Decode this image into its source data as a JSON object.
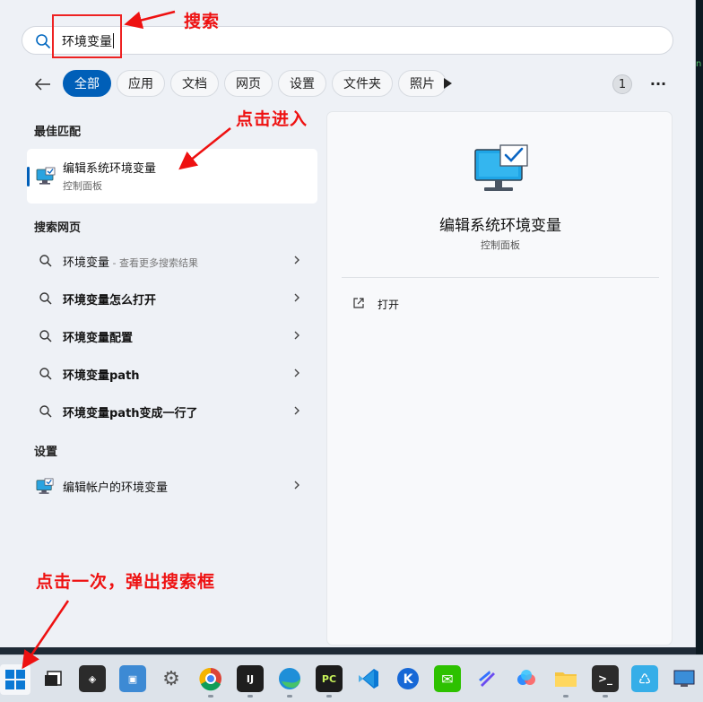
{
  "search": {
    "query": "环境变量"
  },
  "filters": [
    "全部",
    "应用",
    "文档",
    "网页",
    "设置",
    "文件夹",
    "照片"
  ],
  "active_filter": "全部",
  "results_count": "1",
  "best_match": {
    "heading": "最佳匹配",
    "title": "编辑系统环境变量",
    "subtitle": "控制面板"
  },
  "web_search": {
    "heading": "搜索网页",
    "items": [
      {
        "text": "环境变量",
        "suffix": " - 查看更多搜索结果"
      },
      {
        "text": "环境变量怎么打开",
        "suffix": ""
      },
      {
        "text": "环境变量配置",
        "suffix": ""
      },
      {
        "text": "环境变量path",
        "suffix": ""
      },
      {
        "text": "环境变量path变成一行了",
        "suffix": ""
      }
    ]
  },
  "settings": {
    "heading": "设置",
    "items": [
      {
        "text": "编辑帐户的环境变量"
      }
    ]
  },
  "detail": {
    "title": "编辑系统环境变量",
    "subtitle": "控制面板",
    "action": "打开"
  },
  "annotations": {
    "search": "搜索",
    "click_enter": "点击进入",
    "click_start": "点击一次，弹出搜索框"
  },
  "colors": {
    "accent": "#005fb8",
    "annotation": "#ee1111"
  },
  "taskbar": [
    "start-button",
    "task-view",
    "kingsoft",
    "screen-tool",
    "settings",
    "chrome",
    "intellij-idea",
    "edge",
    "pycharm",
    "vscode",
    "kkfileview",
    "wechat",
    "feishu",
    "baidu-netdisk",
    "file-explorer",
    "terminal",
    "recycle",
    "remote-desktop"
  ]
}
